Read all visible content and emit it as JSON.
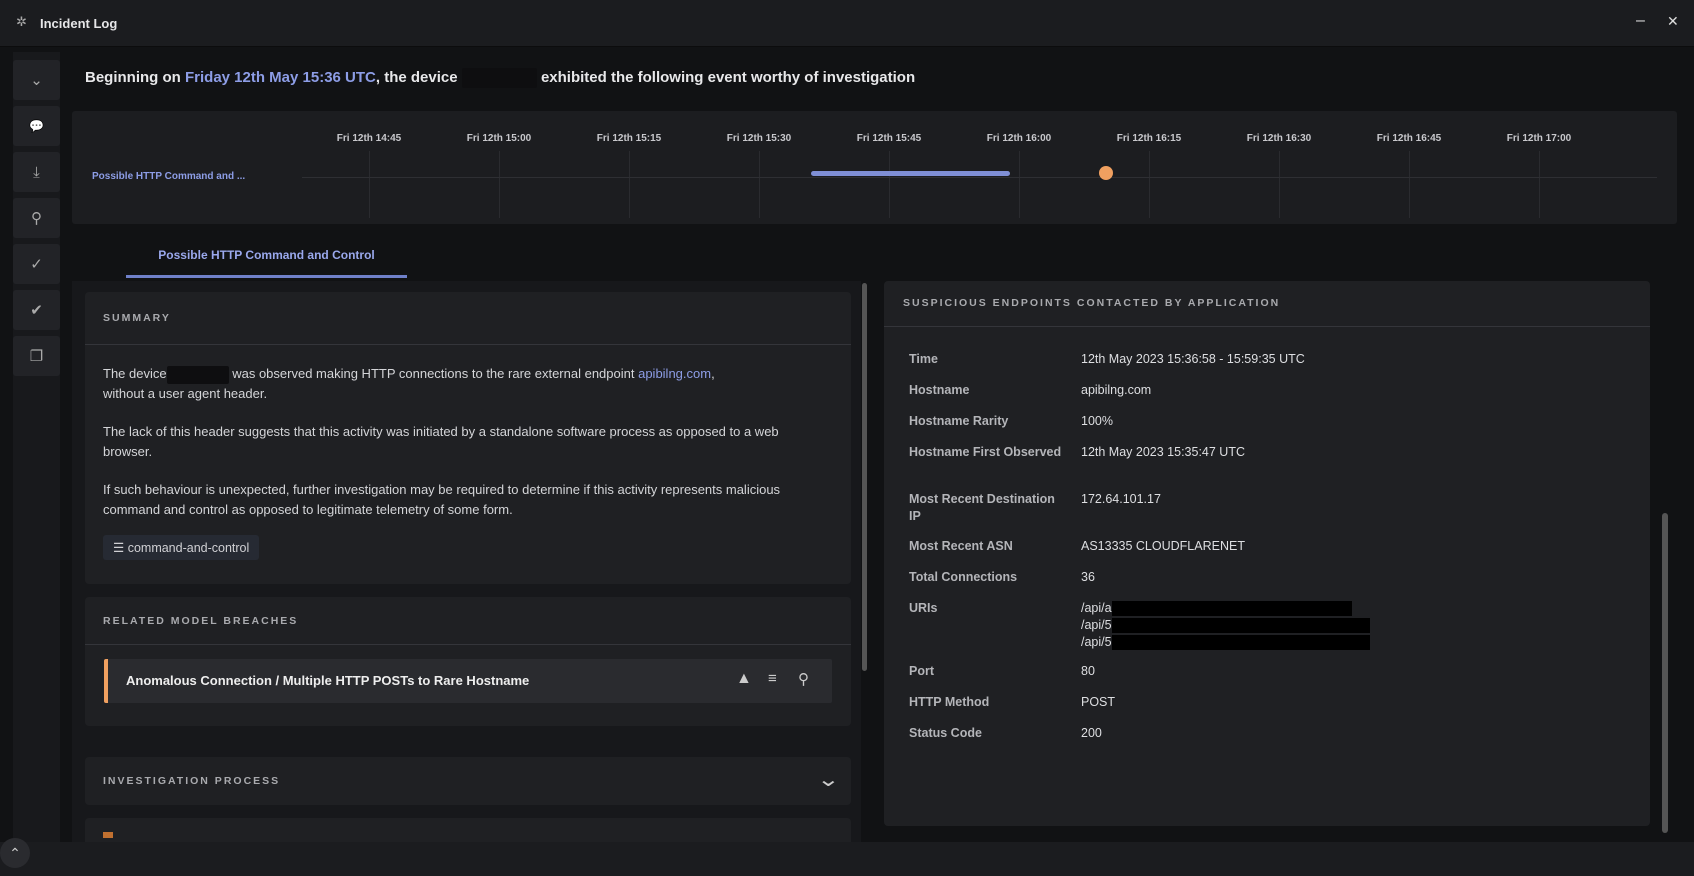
{
  "window": {
    "title": "Incident Log",
    "minimize": "–",
    "close": "✕"
  },
  "sidebar": {
    "items": [
      {
        "icon": "chevrons-down-icon",
        "glyph": "⌄"
      },
      {
        "icon": "comment-icon",
        "glyph": "💬"
      },
      {
        "icon": "download-icon",
        "glyph": "⤓"
      },
      {
        "icon": "pin-icon",
        "glyph": "⚲"
      },
      {
        "icon": "check-icon",
        "glyph": "✓"
      },
      {
        "icon": "double-check-icon",
        "glyph": "✔"
      },
      {
        "icon": "copy-icon",
        "glyph": "❐"
      }
    ],
    "collapse_glyph": "⌃"
  },
  "headline": {
    "prefix": "Beginning on ",
    "date": "Friday 12th May 15:36 UTC",
    "middle": ", the device ",
    "suffix": "exhibited the following event worthy of investigation"
  },
  "timeline": {
    "ticks": [
      "Fri 12th 14:45",
      "Fri 12th 15:00",
      "Fri 12th 15:15",
      "Fri 12th 15:30",
      "Fri 12th 15:45",
      "Fri 12th 16:00",
      "Fri 12th 16:15",
      "Fri 12th 16:30",
      "Fri 12th 16:45",
      "Fri 12th 17:00"
    ],
    "row_label": "Possible HTTP Command and ...",
    "event_start_min": -9,
    "event_end_min": 14,
    "marker_min": 25,
    "colors": {
      "bar": "#7f8fd6",
      "marker": "#f0a060"
    }
  },
  "tab": {
    "label": "Possible HTTP Command and Control"
  },
  "summary": {
    "title": "SUMMARY",
    "p1_a": "The device",
    "p1_b": "was observed making HTTP connections to the rare external endpoint ",
    "p1_link": "apibilng.com",
    "p1_c": ",",
    "p1_d": "without a user agent header.",
    "p2": "The lack of this header suggests that this activity was initiated by a standalone software process as opposed to a web browser.",
    "p3": "If such behaviour is unexpected, further investigation may be required to determine if this activity represents malicious command and control as opposed to legitimate telemetry of some form.",
    "tag": "command-and-control"
  },
  "breaches": {
    "title": "RELATED MODEL BREACHES",
    "items": [
      {
        "name": "Anomalous Connection / Multiple HTTP POSTs to Rare Hostname"
      }
    ]
  },
  "investigation": {
    "title": "INVESTIGATION PROCESS"
  },
  "endpoints": {
    "title": "SUSPICIOUS ENDPOINTS CONTACTED BY APPLICATION",
    "rows": [
      {
        "k": "Time",
        "v": "12th May 2023 15:36:58 - 15:59:35 UTC"
      },
      {
        "k": "Hostname",
        "v": "apibilng.com"
      },
      {
        "k": "Hostname Rarity",
        "v": "100%"
      },
      {
        "k": "Hostname First Observed",
        "v": "12th May 2023 15:35:47 UTC"
      },
      {
        "k": "Most Recent Destination IP",
        "v": "172.64.101.17"
      },
      {
        "k": "Most Recent ASN",
        "v": "AS13335 CLOUDFLARENET"
      },
      {
        "k": "Total Connections",
        "v": "36"
      },
      {
        "k": "URIs",
        "v": ""
      },
      {
        "k": "Port",
        "v": "80"
      },
      {
        "k": "HTTP Method",
        "v": "POST"
      },
      {
        "k": "Status Code",
        "v": "200"
      }
    ],
    "uris": [
      "/api/a",
      "/api/5",
      "/api/5"
    ]
  }
}
